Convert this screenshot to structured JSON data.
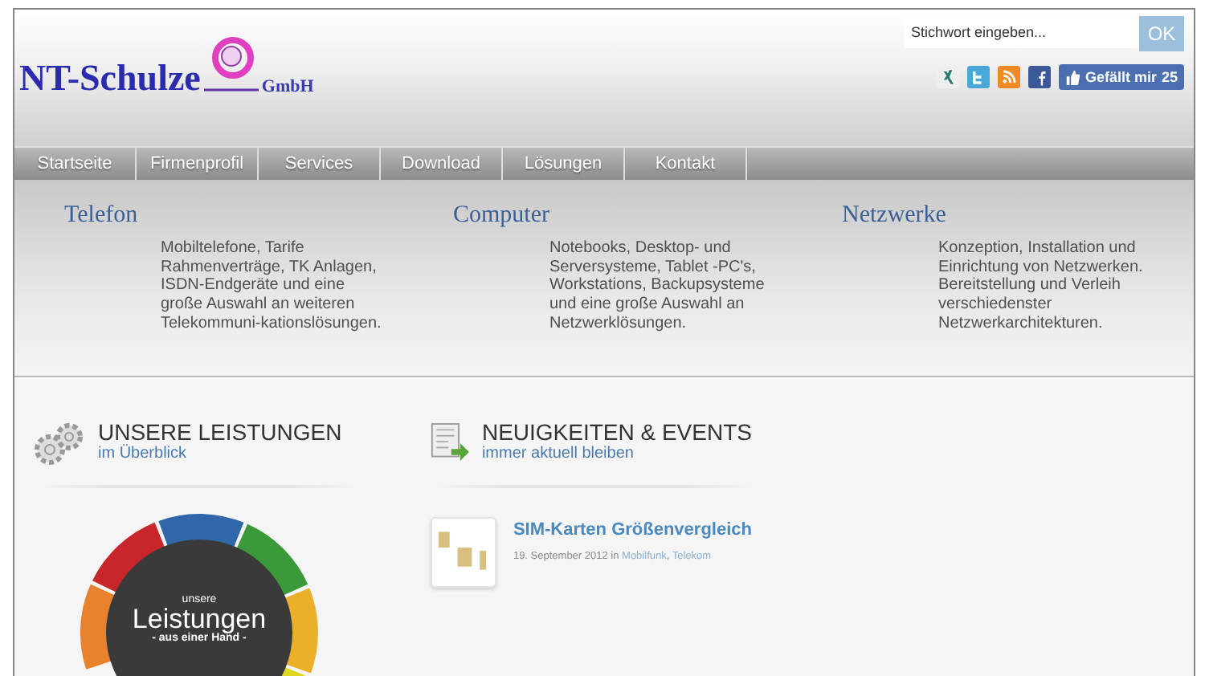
{
  "header": {
    "logo": {
      "name": "NT-Schulze",
      "suffix": "GmbH"
    },
    "search": {
      "placeholder": "Stichwort eingeben...",
      "button": "OK"
    },
    "social": [
      {
        "kind": "xing"
      },
      {
        "kind": "twitter"
      },
      {
        "kind": "rss"
      },
      {
        "kind": "facebook"
      }
    ],
    "like": {
      "label": "Gefällt mir",
      "count": "25"
    }
  },
  "nav": [
    {
      "label": "Startseite",
      "selected": false
    },
    {
      "label": "Firmenprofil",
      "selected": false
    },
    {
      "label": "Services",
      "selected": false
    },
    {
      "label": "Download",
      "selected": false
    },
    {
      "label": "Lösungen",
      "selected": false
    },
    {
      "label": "Kontakt",
      "selected": false
    }
  ],
  "mega": [
    {
      "title": "Telefon",
      "text": "Mobiltelefone, Tarife Rahmenverträge, TK Anlagen, ISDN-Endgeräte und eine große Auswahl an weiteren Telekommuni-kationslösungen."
    },
    {
      "title": "Computer",
      "text": "Notebooks, Desktop- und Serversysteme, Tablet -PC's, Workstations, Backupsysteme und eine große Auswahl an Netzwerklösungen."
    },
    {
      "title": "Netzwerke",
      "text": "Konzeption, Installation und Einrichtung von Netzwerken. Bereitstellung und Verleih verschiedenster Netzwerkarchitekturen."
    }
  ],
  "sections": [
    {
      "kind": "services",
      "title": "UNSERE LEISTUNGEN",
      "subtitle": "im Überblick",
      "wheel": {
        "top": "unsere",
        "main": "Leistungen",
        "bottom": "- aus einer Hand -"
      }
    },
    {
      "kind": "news",
      "title": "NEUIGKEITEN & EVENTS",
      "subtitle": "immer aktuell bleiben",
      "posts": [
        {
          "title": "SIM-Karten Größenvergleich",
          "date": "19. September 2012 in",
          "tags": [
            "Mobilfunk",
            "Telekom"
          ],
          "separator": ","
        }
      ]
    }
  ]
}
